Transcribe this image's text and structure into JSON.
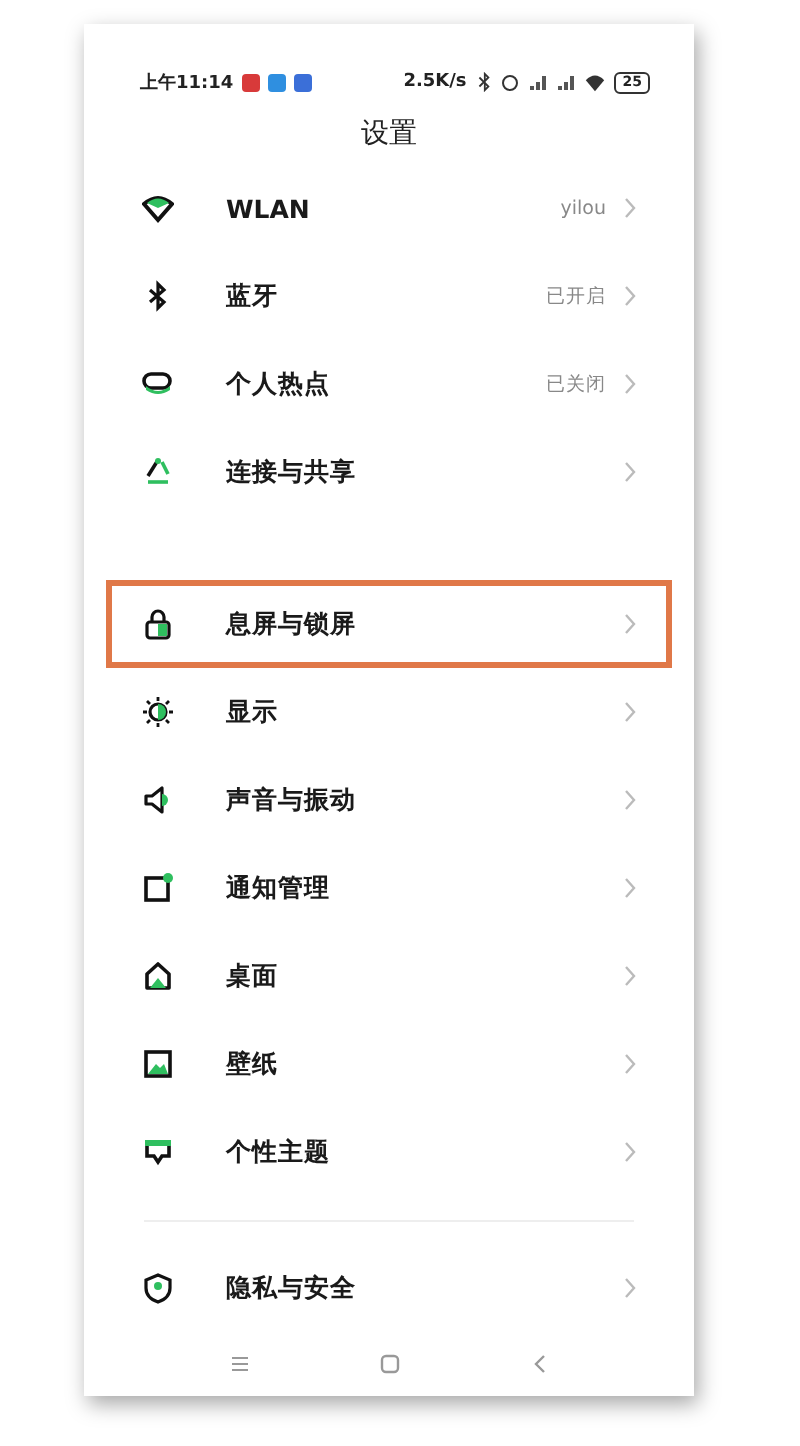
{
  "status_bar": {
    "time": "上午11:14",
    "notifications": [
      {
        "color": "#d83a3a"
      },
      {
        "color": "#2f8fe0"
      },
      {
        "color": "#3b6fd8"
      }
    ],
    "speed": "2.5K/s",
    "battery": "25"
  },
  "title": "设置",
  "groups": [
    {
      "items": [
        {
          "label": "WLAN",
          "value": "yilou",
          "highlighted": false
        },
        {
          "label": "蓝牙",
          "value": "已开启",
          "highlighted": false
        },
        {
          "label": "个人热点",
          "value": "已关闭",
          "highlighted": false
        },
        {
          "label": "连接与共享",
          "highlighted": false
        }
      ]
    },
    {
      "items": [
        {
          "label": "息屏与锁屏",
          "highlighted": true
        },
        {
          "label": "显示",
          "highlighted": false
        },
        {
          "label": "声音与振动",
          "highlighted": false
        },
        {
          "label": "通知管理",
          "highlighted": false
        },
        {
          "label": "桌面",
          "highlighted": false
        },
        {
          "label": "壁纸",
          "highlighted": false
        },
        {
          "label": "个性主题",
          "highlighted": false
        }
      ]
    },
    {
      "items": [
        {
          "label": "隐私与安全",
          "highlighted": false
        }
      ]
    }
  ]
}
